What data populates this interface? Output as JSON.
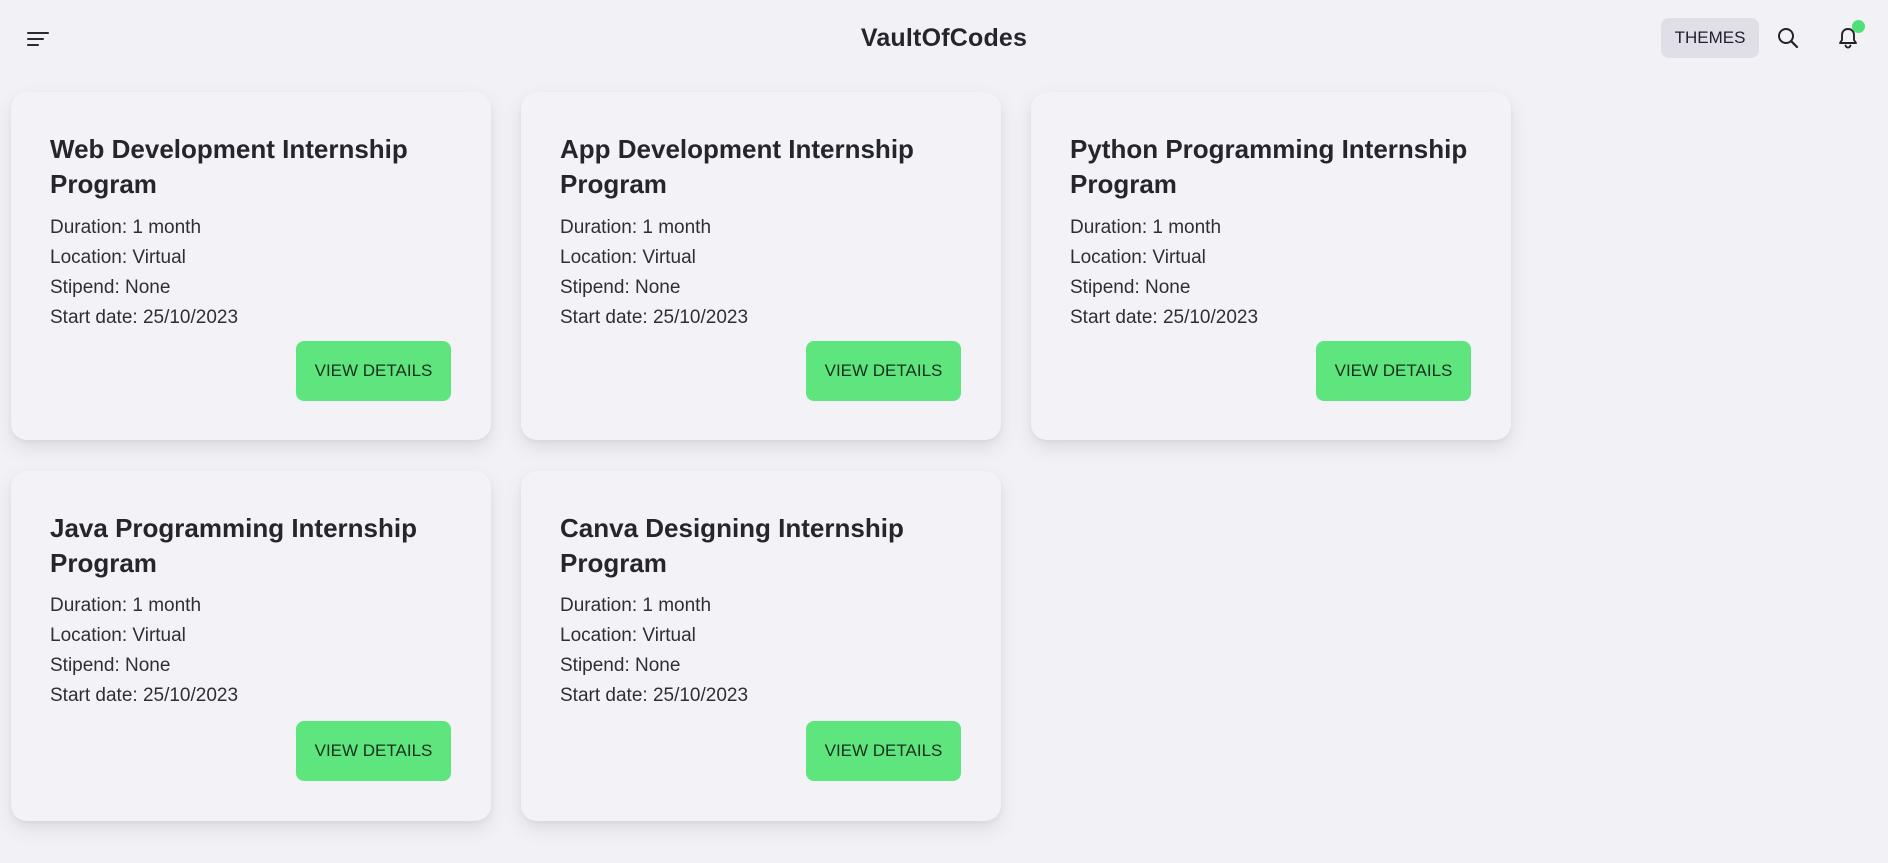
{
  "header": {
    "brand": "VaultOfCodes",
    "themes_label": "THEMES",
    "icons": {
      "menu": "menu-lines-icon",
      "search": "search-icon",
      "notifications": "bell-icon"
    },
    "notification_dot_color": "#4fe07a"
  },
  "labels": {
    "duration": "Duration:",
    "location": "Location:",
    "stipend": "Stipend:",
    "start_date": "Start date:"
  },
  "button_color": "#5ee57d",
  "cards": [
    {
      "title": "Web Development Internship Program",
      "duration": "Duration: 1 month",
      "location": "Location: Virtual",
      "stipend": "Stipend: None",
      "start_date": "Start date: 25/10/2023",
      "button": "VIEW DETAILS"
    },
    {
      "title": "App Development Internship Program",
      "duration": "Duration: 1 month",
      "location": "Location: Virtual",
      "stipend": "Stipend: None",
      "start_date": "Start date: 25/10/2023",
      "button": "VIEW DETAILS"
    },
    {
      "title": "Python Programming Internship Program",
      "duration": "Duration: 1 month",
      "location": "Location: Virtual",
      "stipend": "Stipend: None",
      "start_date": "Start date: 25/10/2023",
      "button": "VIEW DETAILS"
    },
    {
      "title": "Java Programming Internship Program",
      "duration": "Duration: 1 month",
      "location": "Location: Virtual",
      "stipend": "Stipend: None",
      "start_date": "Start date: 25/10/2023",
      "button": "VIEW DETAILS"
    },
    {
      "title": "Canva Designing Internship Program",
      "duration": "Duration: 1 month",
      "location": "Location: Virtual",
      "stipend": "Stipend: None",
      "start_date": "Start date: 25/10/2023",
      "button": "VIEW DETAILS"
    }
  ]
}
